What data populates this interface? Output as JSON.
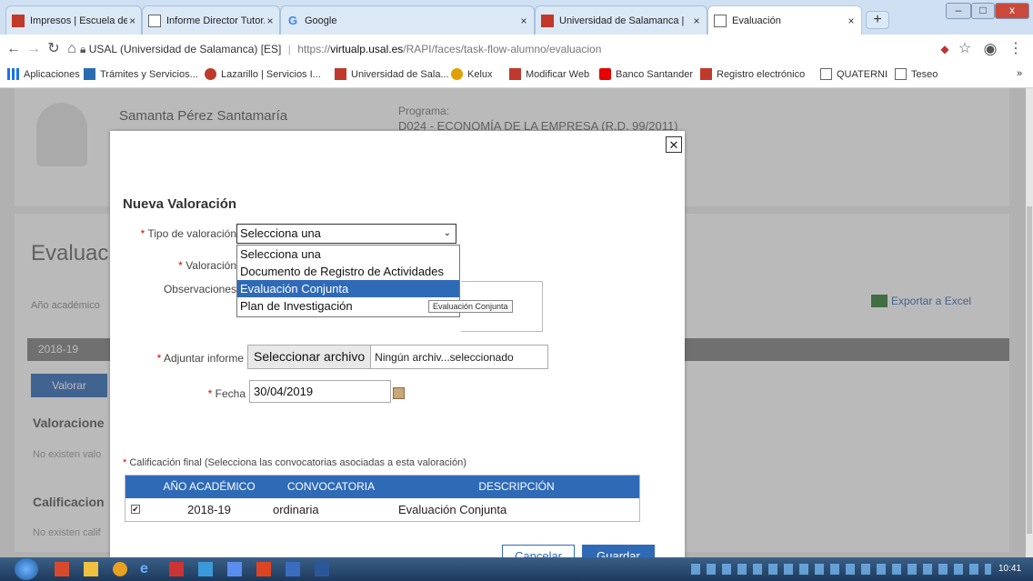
{
  "browser": {
    "tabs": [
      {
        "label": "Impresos | Escuela de Docto",
        "icon": "usal-icon",
        "active": false
      },
      {
        "label": "Informe Director Tutor.pdf",
        "icon": "document-icon",
        "active": false
      },
      {
        "label": "Google",
        "icon": "google-icon",
        "active": false
      },
      {
        "label": "Universidad de Salamanca |",
        "icon": "usal-icon",
        "active": false
      },
      {
        "label": "Evaluación",
        "icon": "document-icon",
        "active": true
      }
    ],
    "close_glyph": "×",
    "new_tab_glyph": "+",
    "window_controls": {
      "minimize": "–",
      "maximize": "□",
      "close": "x"
    },
    "address": {
      "site_label": "USAL (Universidad de Salamanca) [ES]",
      "separator": "|",
      "url_prefix": "https://",
      "url_host": "virtualp.usal.es",
      "url_path": "/RAPI/faces/task-flow-alumno/evaluacion"
    },
    "bookmarks": [
      {
        "label": "Aplicaciones",
        "icon": "apps-grid-icon",
        "color": "#1a73e8"
      },
      {
        "label": "Trámites y Servicios...",
        "icon": "folder-icon",
        "color": "#2b6cb0"
      },
      {
        "label": "Lazarillo | Servicios I...",
        "icon": "lazarillo-icon",
        "color": "#c0392b"
      },
      {
        "label": "Universidad de Sala...",
        "icon": "usal-icon",
        "color": "#c0392b"
      },
      {
        "label": "Kelux",
        "icon": "kelux-icon",
        "color": "#e0a000"
      },
      {
        "label": "Modificar Web",
        "icon": "usal-icon",
        "color": "#c0392b"
      },
      {
        "label": "Banco Santander",
        "icon": "santander-icon",
        "color": "#e60000"
      },
      {
        "label": "Registro electrónico",
        "icon": "usal-icon",
        "color": "#c0392b"
      },
      {
        "label": "QUATERNI",
        "icon": "document-icon",
        "color": "#555555"
      },
      {
        "label": "Teseo",
        "icon": "document-icon",
        "color": "#555555"
      }
    ],
    "bookmarks_more": "»"
  },
  "page": {
    "student_name": "Samanta Pérez Santamaría",
    "program_label": "Programa:",
    "program_value": "D024 - ECONOMÍA DE LA EMPRESA (R.D. 99/2011)",
    "section_title": "Evaluac",
    "year_label": "Año académico",
    "export_label": "Exportar a Excel",
    "year_bar": "2018-19",
    "valorar_button": "Valorar",
    "valoraciones_title": "Valoracione",
    "valoraciones_empty": "No existen valo",
    "calificaciones_title": "Calificacion",
    "calificaciones_empty": "No existen calif"
  },
  "modal": {
    "close_glyph": "✕",
    "title": "Nueva Valoración",
    "required_mark": "*",
    "tipo_label": "Tipo de valoración",
    "tipo_selected": "Selecciona una",
    "tipo_options": [
      "Selecciona una",
      "Documento de Registro de Actividades",
      "Evaluación Conjunta",
      "Plan de Investigación"
    ],
    "tipo_highlighted_index": 2,
    "tooltip": "Evaluación Conjunta",
    "valoracion_label": "Valoración",
    "observaciones_label": "Observaciones",
    "adjuntar_label": "Adjuntar informe",
    "file_button": "Seleccionar archivo",
    "file_status": "Ningún archiv...seleccionado",
    "fecha_label": "Fecha",
    "fecha_value": "30/04/2019",
    "calificacion_note": "Calificación final (Selecciona las convocatorias asociadas a esta valoración)",
    "table": {
      "headers": [
        "AÑO ACADÉMICO",
        "CONVOCATORIA",
        "DESCRIPCIÓN"
      ],
      "rows": [
        {
          "checked": true,
          "year": "2018-19",
          "convocatoria": "ordinaria",
          "descripcion": "Evaluación Conjunta"
        }
      ]
    },
    "cancel_button": "Cancelar",
    "save_button": "Guardar"
  },
  "taskbar": {
    "clock": "10:41"
  },
  "colors": {
    "accent": "#2f6ab7",
    "required": "#dd0000",
    "year_bar": "#808080"
  }
}
